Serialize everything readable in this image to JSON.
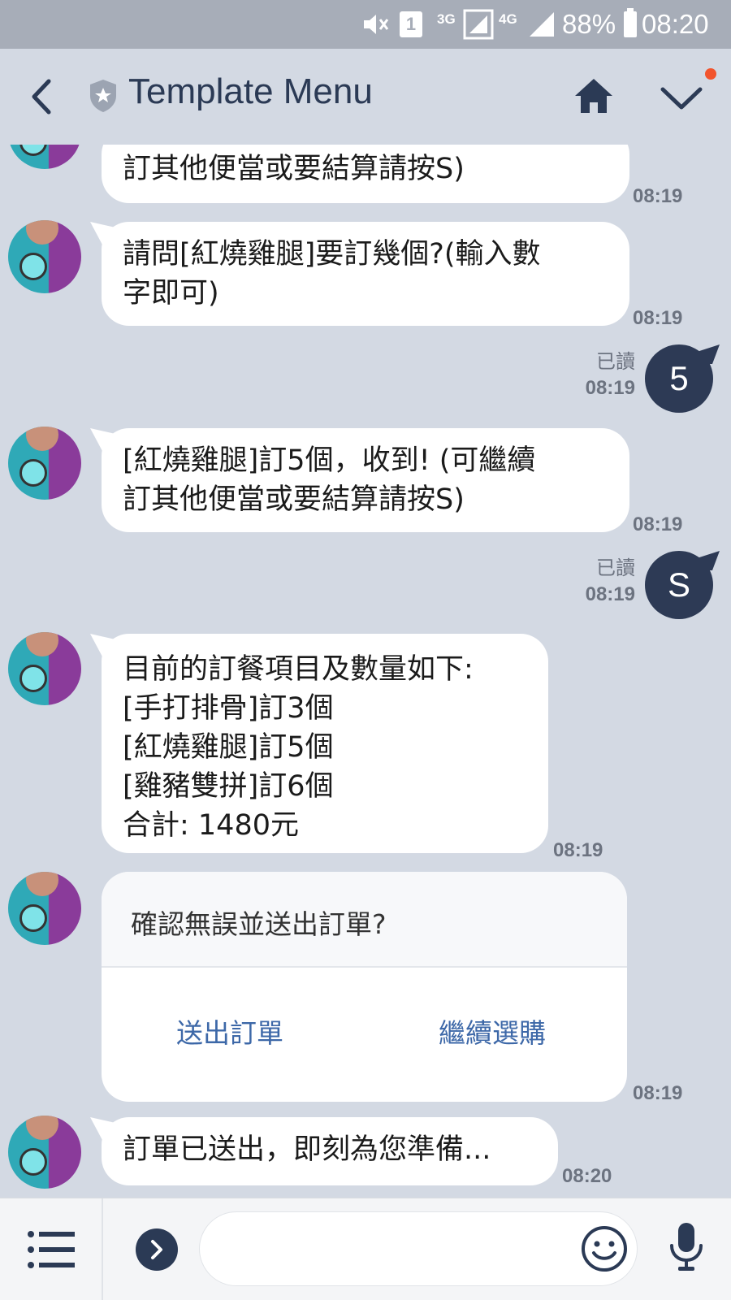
{
  "status_bar": {
    "signal_3g": "3G",
    "signal_4g": "4G",
    "sim_number": "1",
    "battery": "88%",
    "time": "08:20"
  },
  "header": {
    "title": "Template Menu"
  },
  "messages": [
    {
      "text": "訂其他便當或要結算請按S)",
      "time": "08:19"
    },
    {
      "text": "請問[紅燒雞腿]要訂幾個?(輸入數\n字即可)",
      "time": "08:19"
    },
    {
      "read": "已讀",
      "time": "08:19",
      "text": "5"
    },
    {
      "text": "[紅燒雞腿]訂5個，收到! (可繼續\n訂其他便當或要結算請按S)",
      "time": "08:19"
    },
    {
      "read": "已讀",
      "time": "08:19",
      "text": "S"
    },
    {
      "text": "目前的訂餐項目及數量如下:\n[手打排骨]訂3個\n[紅燒雞腿]訂5個\n[雞豬雙拼]訂6個\n合計: 1480元",
      "time": "08:19"
    },
    {
      "text": "訂單已送出，即刻為您準備...",
      "time": "08:20"
    }
  ],
  "confirm_card": {
    "question": "確認無誤並送出訂單?",
    "button_send": "送出訂單",
    "button_continue": "繼續選購",
    "time": "08:19"
  },
  "colors": {
    "background": "#d3d9e3",
    "header_text": "#2b3a55",
    "user_bubble": "#2d3a55",
    "link": "#3d68a8",
    "notification_dot": "#f2542d"
  },
  "icons": [
    "back-icon",
    "shield-star-icon",
    "home-icon",
    "chevron-down-icon",
    "menu-list-icon",
    "expand-arrow-icon",
    "emoji-icon",
    "microphone-icon"
  ]
}
